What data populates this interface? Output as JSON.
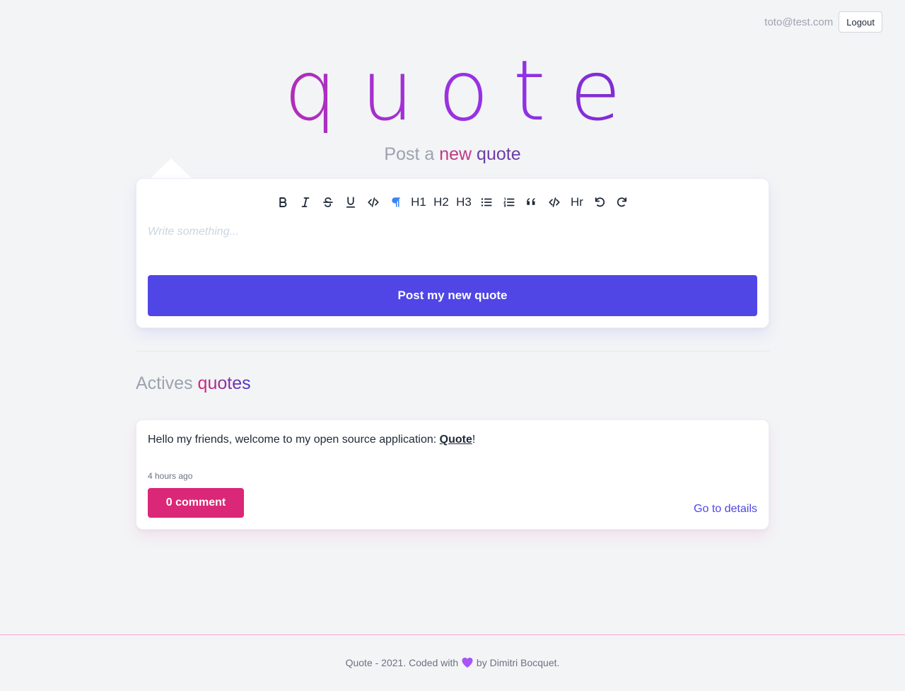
{
  "header": {
    "user_email": "toto@test.com",
    "logout_label": "Logout"
  },
  "logo": {
    "text": "quote"
  },
  "composer": {
    "title_prefix": "Post a",
    "title_word1": "new",
    "title_word2": "quote",
    "toolbar": [
      {
        "name": "bold-icon",
        "label": ""
      },
      {
        "name": "italic-icon",
        "label": ""
      },
      {
        "name": "strikethrough-icon",
        "label": ""
      },
      {
        "name": "underline-icon",
        "label": ""
      },
      {
        "name": "code-icon",
        "label": ""
      },
      {
        "name": "paragraph-icon",
        "label": ""
      },
      {
        "name": "h1",
        "label": "H1"
      },
      {
        "name": "h2",
        "label": "H2"
      },
      {
        "name": "h3",
        "label": "H3"
      },
      {
        "name": "bullet-list-icon",
        "label": ""
      },
      {
        "name": "ordered-list-icon",
        "label": ""
      },
      {
        "name": "blockquote-icon",
        "label": ""
      },
      {
        "name": "code-block-icon",
        "label": ""
      },
      {
        "name": "hr",
        "label": "Hr"
      },
      {
        "name": "undo-icon",
        "label": ""
      },
      {
        "name": "redo-icon",
        "label": ""
      }
    ],
    "placeholder": "Write something...",
    "submit_label": "Post my new quote"
  },
  "feed": {
    "title_prefix": "Actives",
    "title_highlight": "quotes",
    "quotes": [
      {
        "text_before": "Hello my friends, welcome to my open source application:",
        "link_text": "Quote",
        "text_after": "!",
        "time": "4 hours ago",
        "comment_label": "0 comment",
        "details_label": "Go to details"
      }
    ]
  },
  "footer": {
    "text_before": "Quote - 2021. Coded with",
    "text_after": "by Dimitri Bocquet."
  },
  "colors": {
    "primary": "#4f46e5",
    "accent": "#db2777",
    "background": "#f3f4f6"
  }
}
